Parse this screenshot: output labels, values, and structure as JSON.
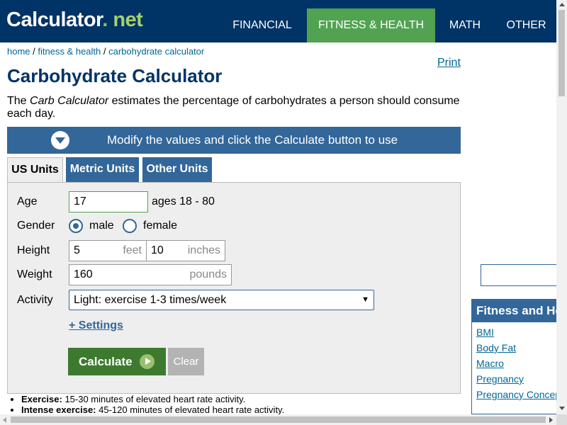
{
  "header": {
    "logo_main": "Calculator",
    "logo_dot": ".",
    "logo_net": " net",
    "nav": [
      "FINANCIAL",
      "FITNESS & HEALTH",
      "MATH",
      "OTHER"
    ],
    "active_nav": "FITNESS & HEALTH"
  },
  "breadcrumb": {
    "home": "home",
    "sep": " / ",
    "section": "fitness & health",
    "current": "carbohydrate calculator"
  },
  "print_label": "Print",
  "title": "Carbohydrate Calculator",
  "intro": {
    "pre": "The ",
    "em": "Carb Calculator",
    "post": " estimates the percentage of carbohydrates a person should consume each day."
  },
  "banner": "Modify the values and click the Calculate button to use",
  "tabs": [
    "US Units",
    "Metric Units",
    "Other Units"
  ],
  "active_tab": "US Units",
  "form": {
    "age_label": "Age",
    "age_value": "17",
    "age_hint": "ages 18 - 80",
    "gender_label": "Gender",
    "gender_male": "male",
    "gender_female": "female",
    "gender_selected": "male",
    "height_label": "Height",
    "height_feet": "5",
    "height_feet_unit": "feet",
    "height_inches": "10",
    "height_inches_unit": "inches",
    "weight_label": "Weight",
    "weight_value": "160",
    "weight_unit": "pounds",
    "activity_label": "Activity",
    "activity_value": "Light: exercise 1-3 times/week",
    "settings_link": "+ Settings",
    "calculate_label": "Calculate",
    "clear_label": "Clear"
  },
  "notes": [
    {
      "term": "Exercise:",
      "text": " 15-30 minutes of elevated heart rate activity."
    },
    {
      "term": "Intense exercise:",
      "text": " 45-120 minutes of elevated heart rate activity."
    }
  ],
  "sidebar": {
    "heading": "Fitness and Health",
    "links": [
      "BMI",
      "Body Fat",
      "Macro",
      "Pregnancy",
      "Pregnancy Conception"
    ]
  },
  "colors": {
    "header_bg": "#003366",
    "nav_active": "#51a351",
    "brand_blue": "#336699",
    "calc_green": "#3d7a2f"
  }
}
